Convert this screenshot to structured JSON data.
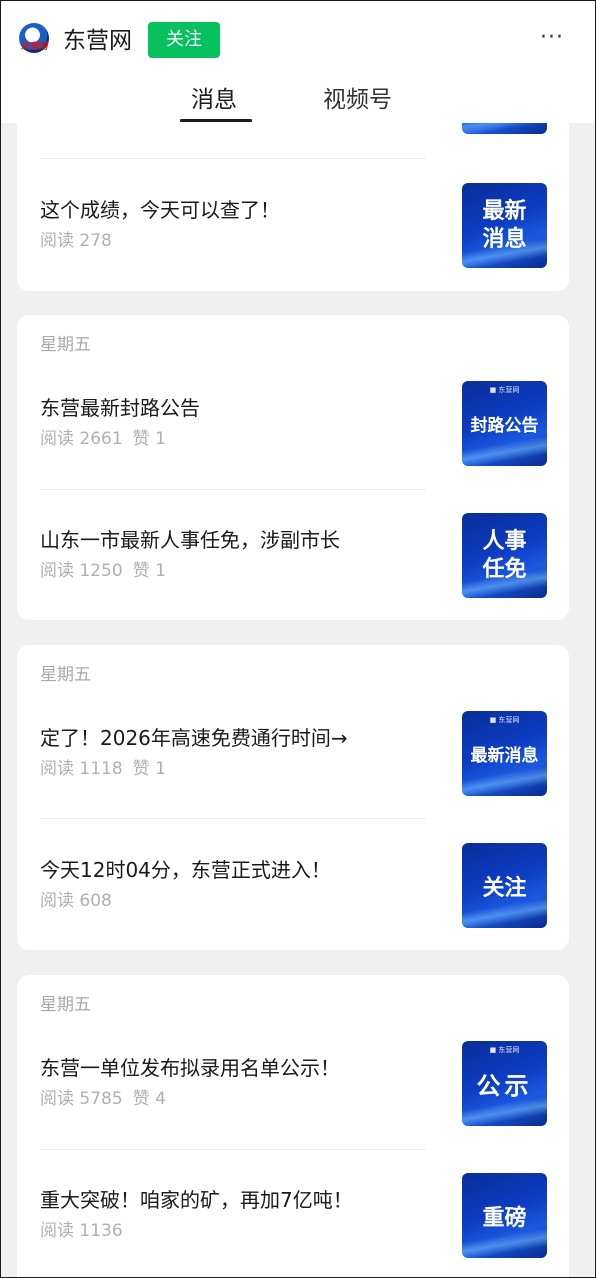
{
  "header": {
    "logo_text": "东营网",
    "app_name": "东营网",
    "follow_label": "关注",
    "more_label": "···",
    "tabs": [
      {
        "label": "消息",
        "active": true
      },
      {
        "label": "视频号",
        "active": false
      }
    ]
  },
  "feed": {
    "card0": {
      "articles": [
        {
          "title": "这个成绩，今天可以查了！",
          "reads": "阅读 278",
          "likes": "",
          "thumb_text": "最新\n消息"
        }
      ]
    },
    "card1": {
      "day": "星期五",
      "articles": [
        {
          "title": "东营最新封路公告",
          "reads": "阅读 2661",
          "likes": "赞 1",
          "thumb_text": "封路公告",
          "thumb_brand": "■ 东营网"
        },
        {
          "title": "山东一市最新人事任免，涉副市长",
          "reads": "阅读 1250",
          "likes": "赞 1",
          "thumb_text": "人事\n任免"
        }
      ]
    },
    "card2": {
      "day": "星期五",
      "articles": [
        {
          "title": "定了！2026年高速免费通行时间→",
          "reads": "阅读 1118",
          "likes": "赞 1",
          "thumb_text": "最新消息",
          "thumb_brand": "■ 东营网"
        },
        {
          "title": "今天12时04分，东营正式进入！",
          "reads": "阅读 608",
          "likes": "",
          "thumb_text": "关注"
        }
      ]
    },
    "card3": {
      "day": "星期五",
      "articles": [
        {
          "title": "东营一单位发布拟录用名单公示！",
          "reads": "阅读 5785",
          "likes": "赞 4",
          "thumb_text": "公示",
          "thumb_brand": "■ 东营网"
        },
        {
          "title": "重大突破！咱家的矿，再加7亿吨！",
          "reads": "阅读 1136",
          "likes": "",
          "thumb_text": "重磅"
        }
      ]
    }
  },
  "colors": {
    "follow_green": "#07c160",
    "thumb_blue": "#0d3cc2",
    "meta_gray": "#b0b0b0",
    "page_bg": "#f0f0f0"
  }
}
